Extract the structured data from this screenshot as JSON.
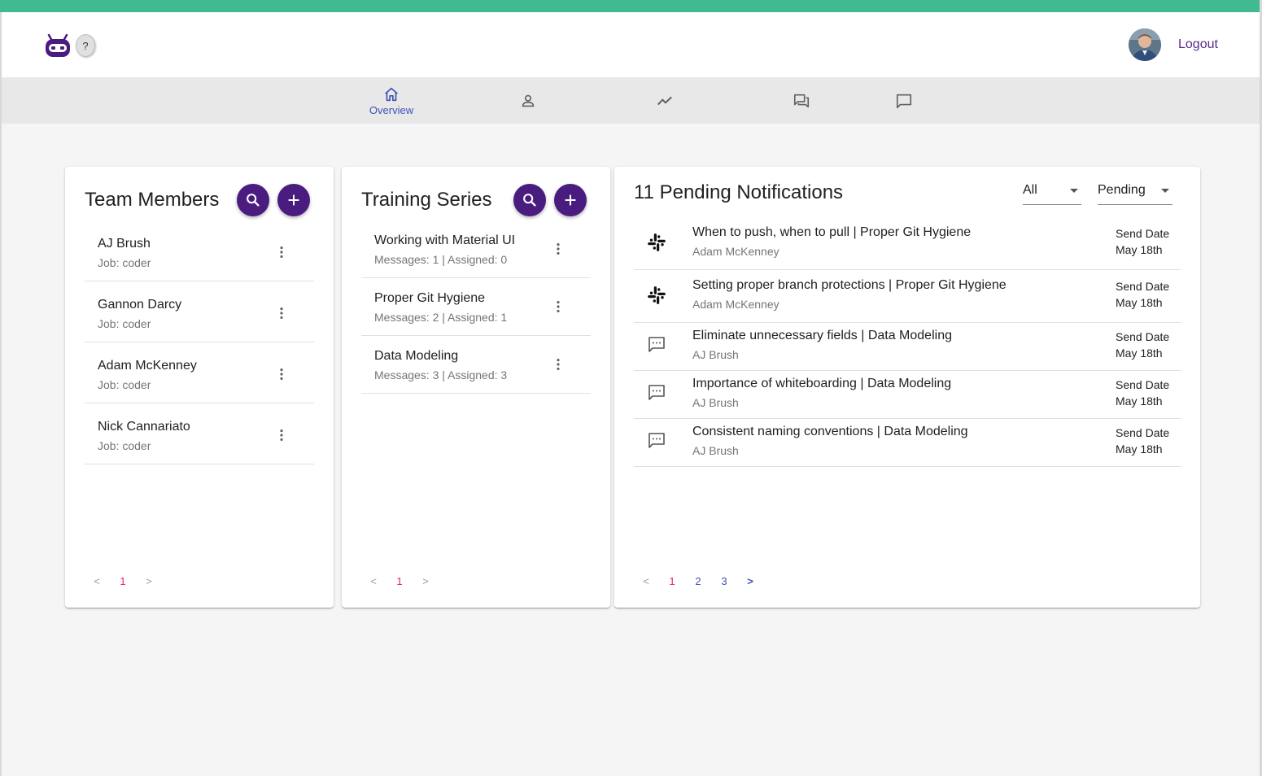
{
  "header": {
    "help_label": "?",
    "logout_label": "Logout",
    "logo_icon": "robot-logo-icon",
    "accent_color": "#40bb91",
    "brand_color": "#4a1c7f"
  },
  "nav": {
    "items": [
      {
        "label": "Overview",
        "icon": "home-icon",
        "active": true
      },
      {
        "label": "",
        "icon": "person-icon",
        "active": false
      },
      {
        "label": "",
        "icon": "trending-icon",
        "active": false
      },
      {
        "label": "",
        "icon": "forum-icon",
        "active": false
      },
      {
        "label": "",
        "icon": "chat-bubble-icon",
        "active": false
      }
    ]
  },
  "team": {
    "title": "Team Members",
    "members": [
      {
        "name": "AJ Brush",
        "job": "Job: coder"
      },
      {
        "name": "Gannon Darcy",
        "job": "Job: coder"
      },
      {
        "name": "Adam McKenney",
        "job": "Job: coder"
      },
      {
        "name": "Nick Cannariato",
        "job": "Job: coder"
      }
    ],
    "pager": {
      "prev": "<",
      "pages": [
        "1"
      ],
      "next": ">"
    }
  },
  "training": {
    "title": "Training Series",
    "series": [
      {
        "name": "Working with Material UI",
        "meta": "Messages: 1 | Assigned: 0"
      },
      {
        "name": "Proper Git Hygiene",
        "meta": "Messages: 2 | Assigned: 1"
      },
      {
        "name": "Data Modeling",
        "meta": "Messages: 3 | Assigned: 3"
      }
    ],
    "pager": {
      "prev": "<",
      "pages": [
        "1"
      ],
      "next": ">"
    }
  },
  "notifications": {
    "title": "11 Pending Notifications",
    "filter_type": "All",
    "filter_status": "Pending",
    "items": [
      {
        "icon": "slack-icon",
        "title": "When to push, when to pull | Proper Git Hygiene",
        "author": "Adam McKenney",
        "date_label": "Send Date",
        "date": "May 18th"
      },
      {
        "icon": "slack-icon",
        "title": "Setting proper branch protections | Proper Git Hygiene",
        "author": "Adam McKenney",
        "date_label": "Send Date",
        "date": "May 18th"
      },
      {
        "icon": "sms-icon",
        "title": "Eliminate unnecessary fields | Data Modeling",
        "author": "AJ Brush",
        "date_label": "Send Date",
        "date": "May 18th"
      },
      {
        "icon": "sms-icon",
        "title": "Importance of whiteboarding | Data Modeling",
        "author": "AJ Brush",
        "date_label": "Send Date",
        "date": "May 18th"
      },
      {
        "icon": "sms-icon",
        "title": "Consistent naming conventions | Data Modeling",
        "author": "AJ Brush",
        "date_label": "Send Date",
        "date": "May 18th"
      }
    ],
    "pager": {
      "prev": "<",
      "pages": [
        "1",
        "2",
        "3"
      ],
      "next": ">"
    }
  }
}
